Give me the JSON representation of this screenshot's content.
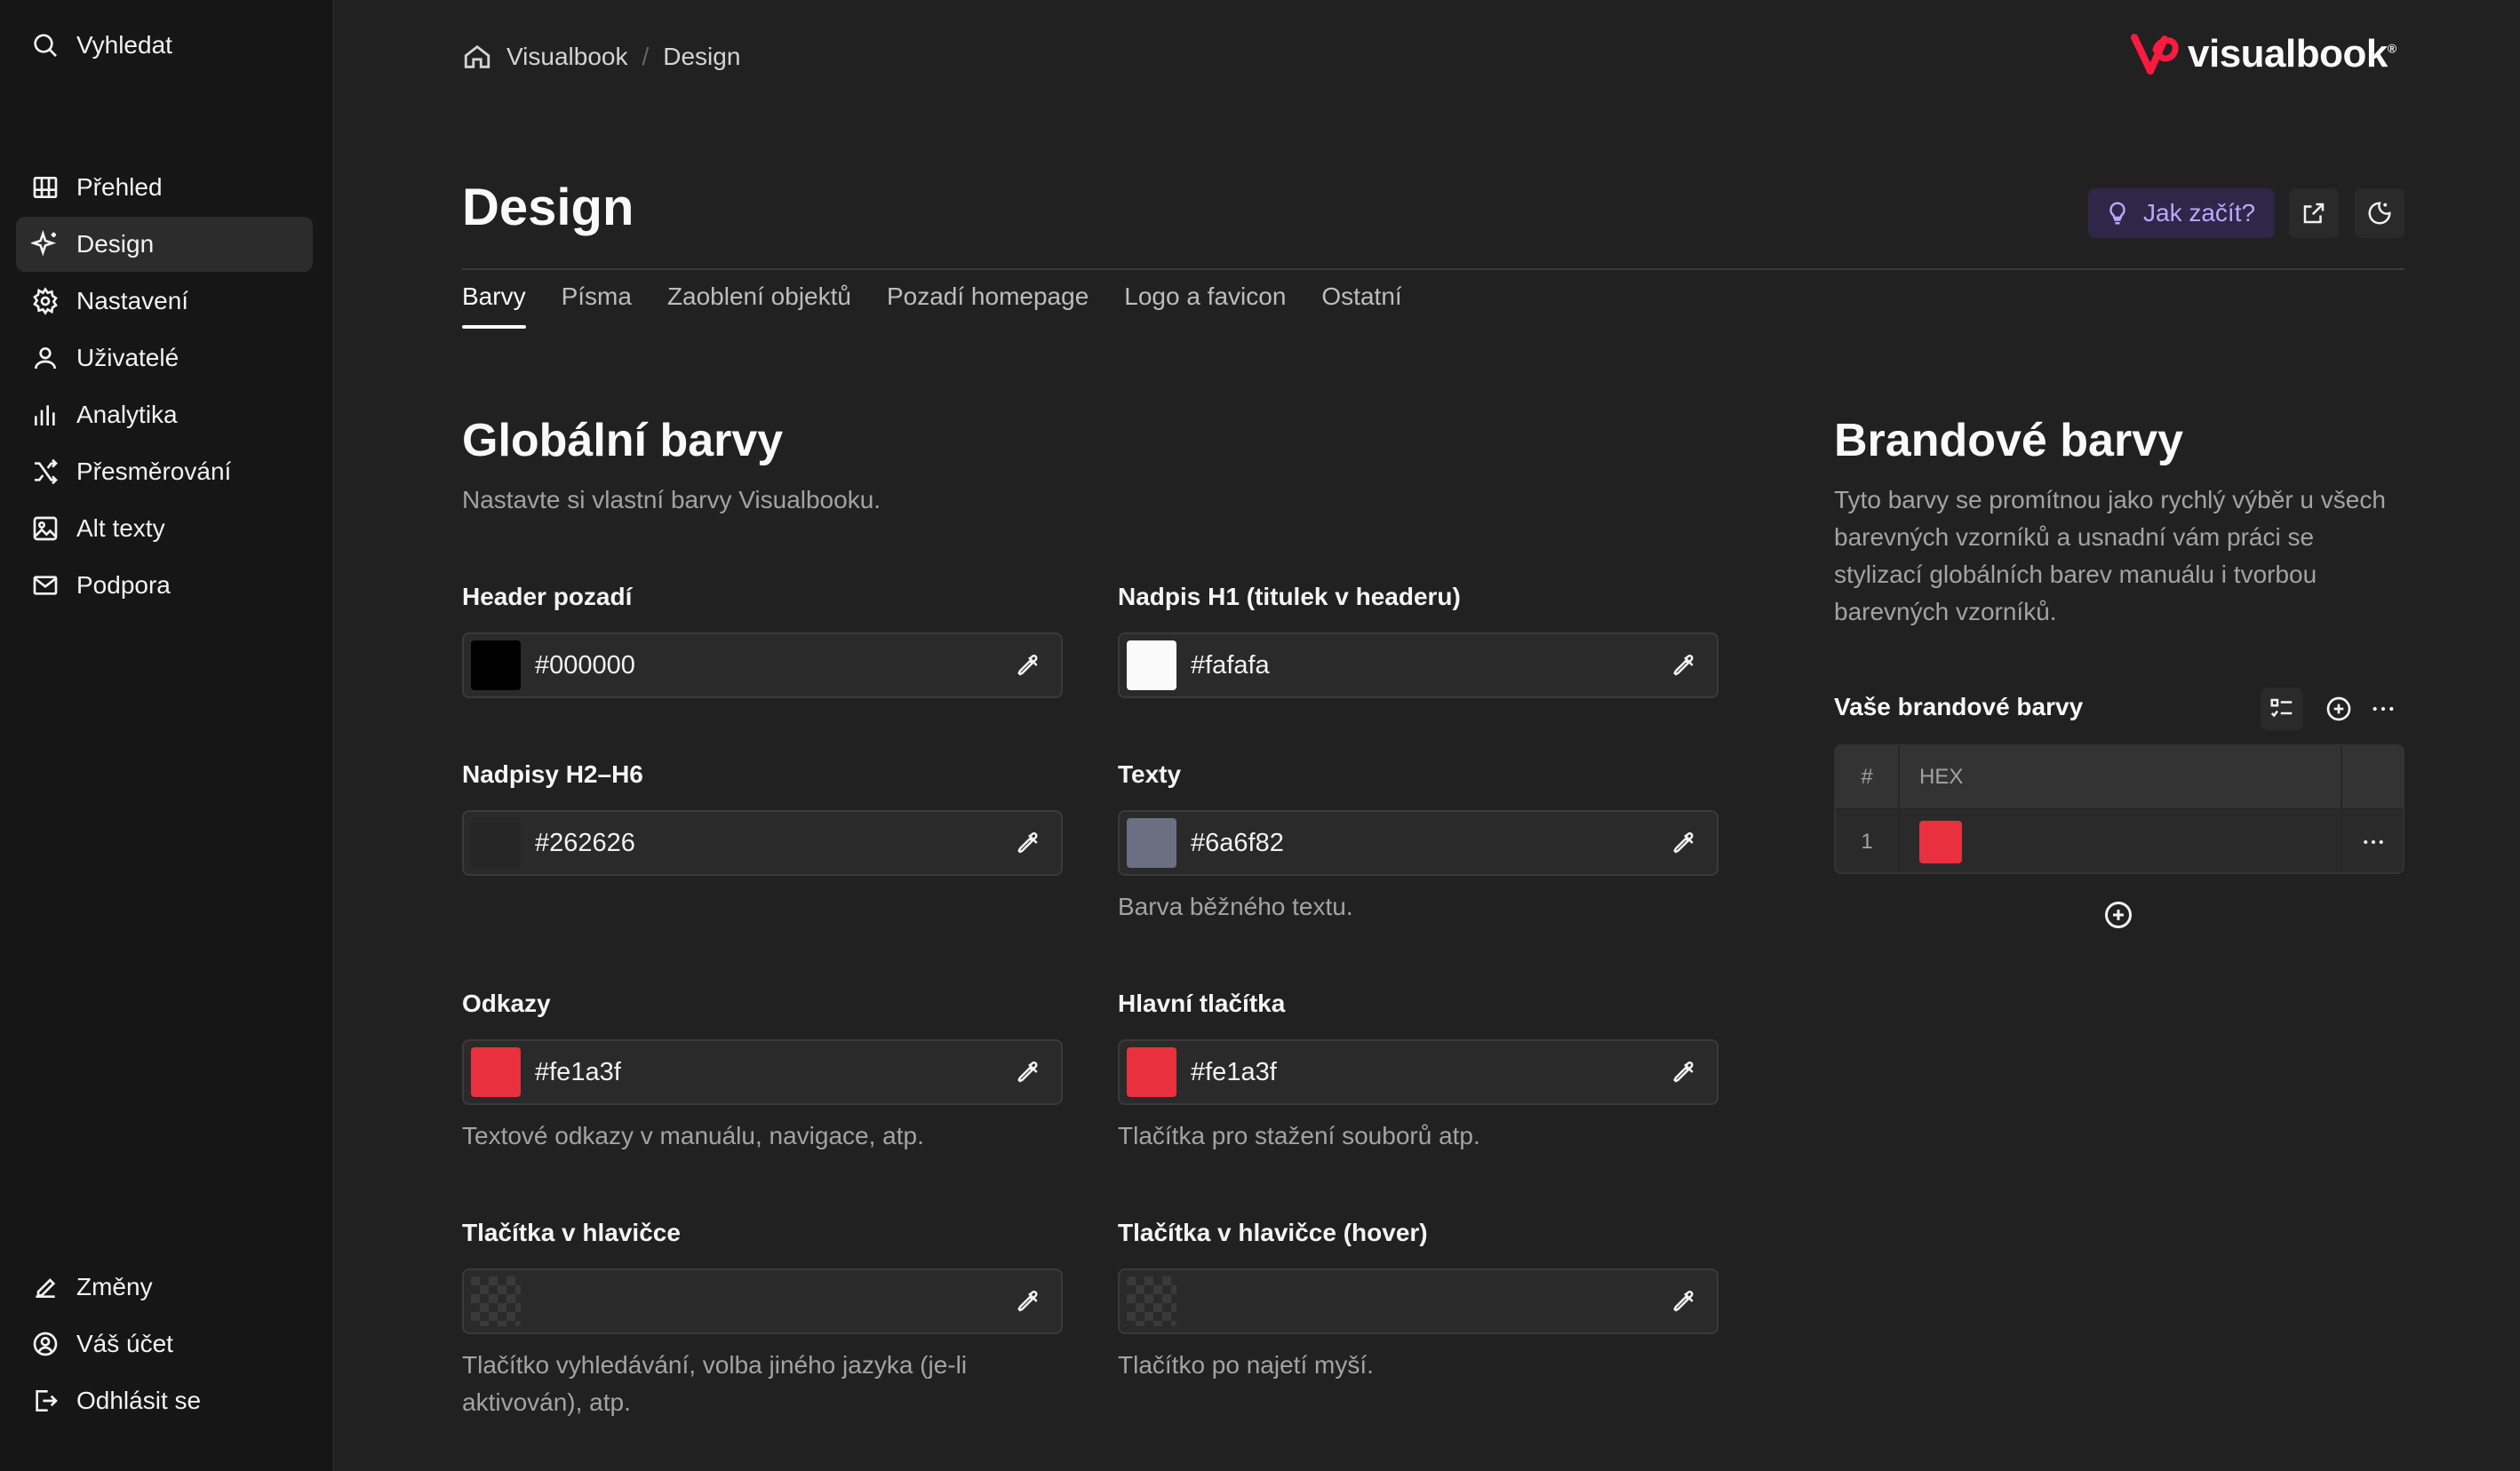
{
  "sidebar": {
    "search": "Vyhledat",
    "nav": [
      {
        "label": "Přehled",
        "icon": "overview-icon"
      },
      {
        "label": "Design",
        "icon": "sparkles-icon",
        "active": true
      },
      {
        "label": "Nastavení",
        "icon": "gear-icon"
      },
      {
        "label": "Uživatelé",
        "icon": "user-icon"
      },
      {
        "label": "Analytika",
        "icon": "chart-icon"
      },
      {
        "label": "Přesměrování",
        "icon": "shuffle-icon"
      },
      {
        "label": "Alt texty",
        "icon": "image-icon"
      },
      {
        "label": "Podpora",
        "icon": "mail-icon"
      }
    ],
    "bottom": [
      {
        "label": "Změny",
        "icon": "pen-icon"
      },
      {
        "label": "Váš účet",
        "icon": "account-icon"
      },
      {
        "label": "Odhlásit se",
        "icon": "logout-icon"
      }
    ]
  },
  "breadcrumb": {
    "root": "Visualbook",
    "separator": "/",
    "current": "Design"
  },
  "logo": {
    "text": "visualbook",
    "mark": "®"
  },
  "header": {
    "title": "Design",
    "help_label": "Jak začít?"
  },
  "tabs": [
    "Barvy",
    "Písma",
    "Zaoblení objektů",
    "Pozadí homepage",
    "Logo a favicon",
    "Ostatní"
  ],
  "global": {
    "title": "Globální barvy",
    "description": "Nastavte si vlastní barvy Visualbooku.",
    "fields": [
      {
        "label": "Header pozadí",
        "value": "#000000",
        "swatch": "#000000",
        "help": ""
      },
      {
        "label": "Nadpis H1 (titulek v headeru)",
        "value": "#fafafa",
        "swatch": "#fafafa",
        "help": ""
      },
      {
        "label": "Nadpisy H2–H6",
        "value": "#262626",
        "swatch": "#262626",
        "help": ""
      },
      {
        "label": "Texty",
        "value": "#6a6f82",
        "swatch": "#6a6f82",
        "help": "Barva běžného textu."
      },
      {
        "label": "Odkazy",
        "value": "#fe1a3f",
        "swatch": "#e8303f",
        "help": "Textové odkazy v manuálu, navigace, atp."
      },
      {
        "label": "Hlavní tlačítka",
        "value": "#fe1a3f",
        "swatch": "#e8303f",
        "help": "Tlačítka pro stažení souborů atp."
      },
      {
        "label": "Tlačítka v hlavičce",
        "value": "",
        "swatch": "transparent",
        "help": "Tlačítko vyhledávání, volba jiného jazyka (je-li aktivován), atp."
      },
      {
        "label": "Tlačítka v hlavičce (hover)",
        "value": "",
        "swatch": "transparent",
        "help": "Tlačítko po najetí myší."
      }
    ]
  },
  "brand": {
    "title": "Brandové barvy",
    "description": "Tyto barvy se promítnou jako rychlý výběr u všech barevných vzorníků a usnadní vám práci se stylizací globálních barev manuálu i tvorbou barevných vzorníků.",
    "list_label": "Vaše brandové barvy",
    "columns": [
      "#",
      "HEX"
    ],
    "rows": [
      {
        "index": "1",
        "color": "#e8303f"
      }
    ]
  },
  "colors": {
    "accent": "#fe1a3f",
    "help_button_bg": "#2e2748",
    "help_button_text": "#b9a8ff"
  }
}
